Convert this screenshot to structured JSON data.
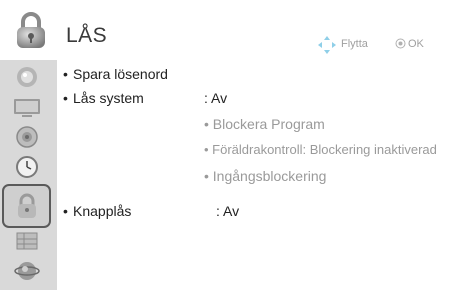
{
  "header": {
    "title": "LÅS",
    "hint_move": "Flytta",
    "hint_ok": "OK"
  },
  "sidebar": {
    "items": [
      {
        "icon": "picture-icon"
      },
      {
        "icon": "screen-icon"
      },
      {
        "icon": "audio-icon"
      },
      {
        "icon": "clock-icon"
      },
      {
        "icon": "lock-icon",
        "selected": true
      },
      {
        "icon": "options-icon"
      },
      {
        "icon": "network-icon"
      }
    ]
  },
  "menu": {
    "save_password": "Spara lösenord",
    "lock_system": {
      "label": "Lås system",
      "value": ": Av"
    },
    "sub_items": [
      "Blockera Program",
      "Föräldrakontroll: Blockering inaktiverad",
      "Ingångsblockering"
    ],
    "key_lock": {
      "label": "Knapplås",
      "value": ": Av"
    }
  },
  "colors": {
    "sidebar_bg": "#d9d9d9",
    "selected_border": "#5a5a5a",
    "disabled_text": "#9a9a9a",
    "hint_text": "#a0a0a0"
  }
}
